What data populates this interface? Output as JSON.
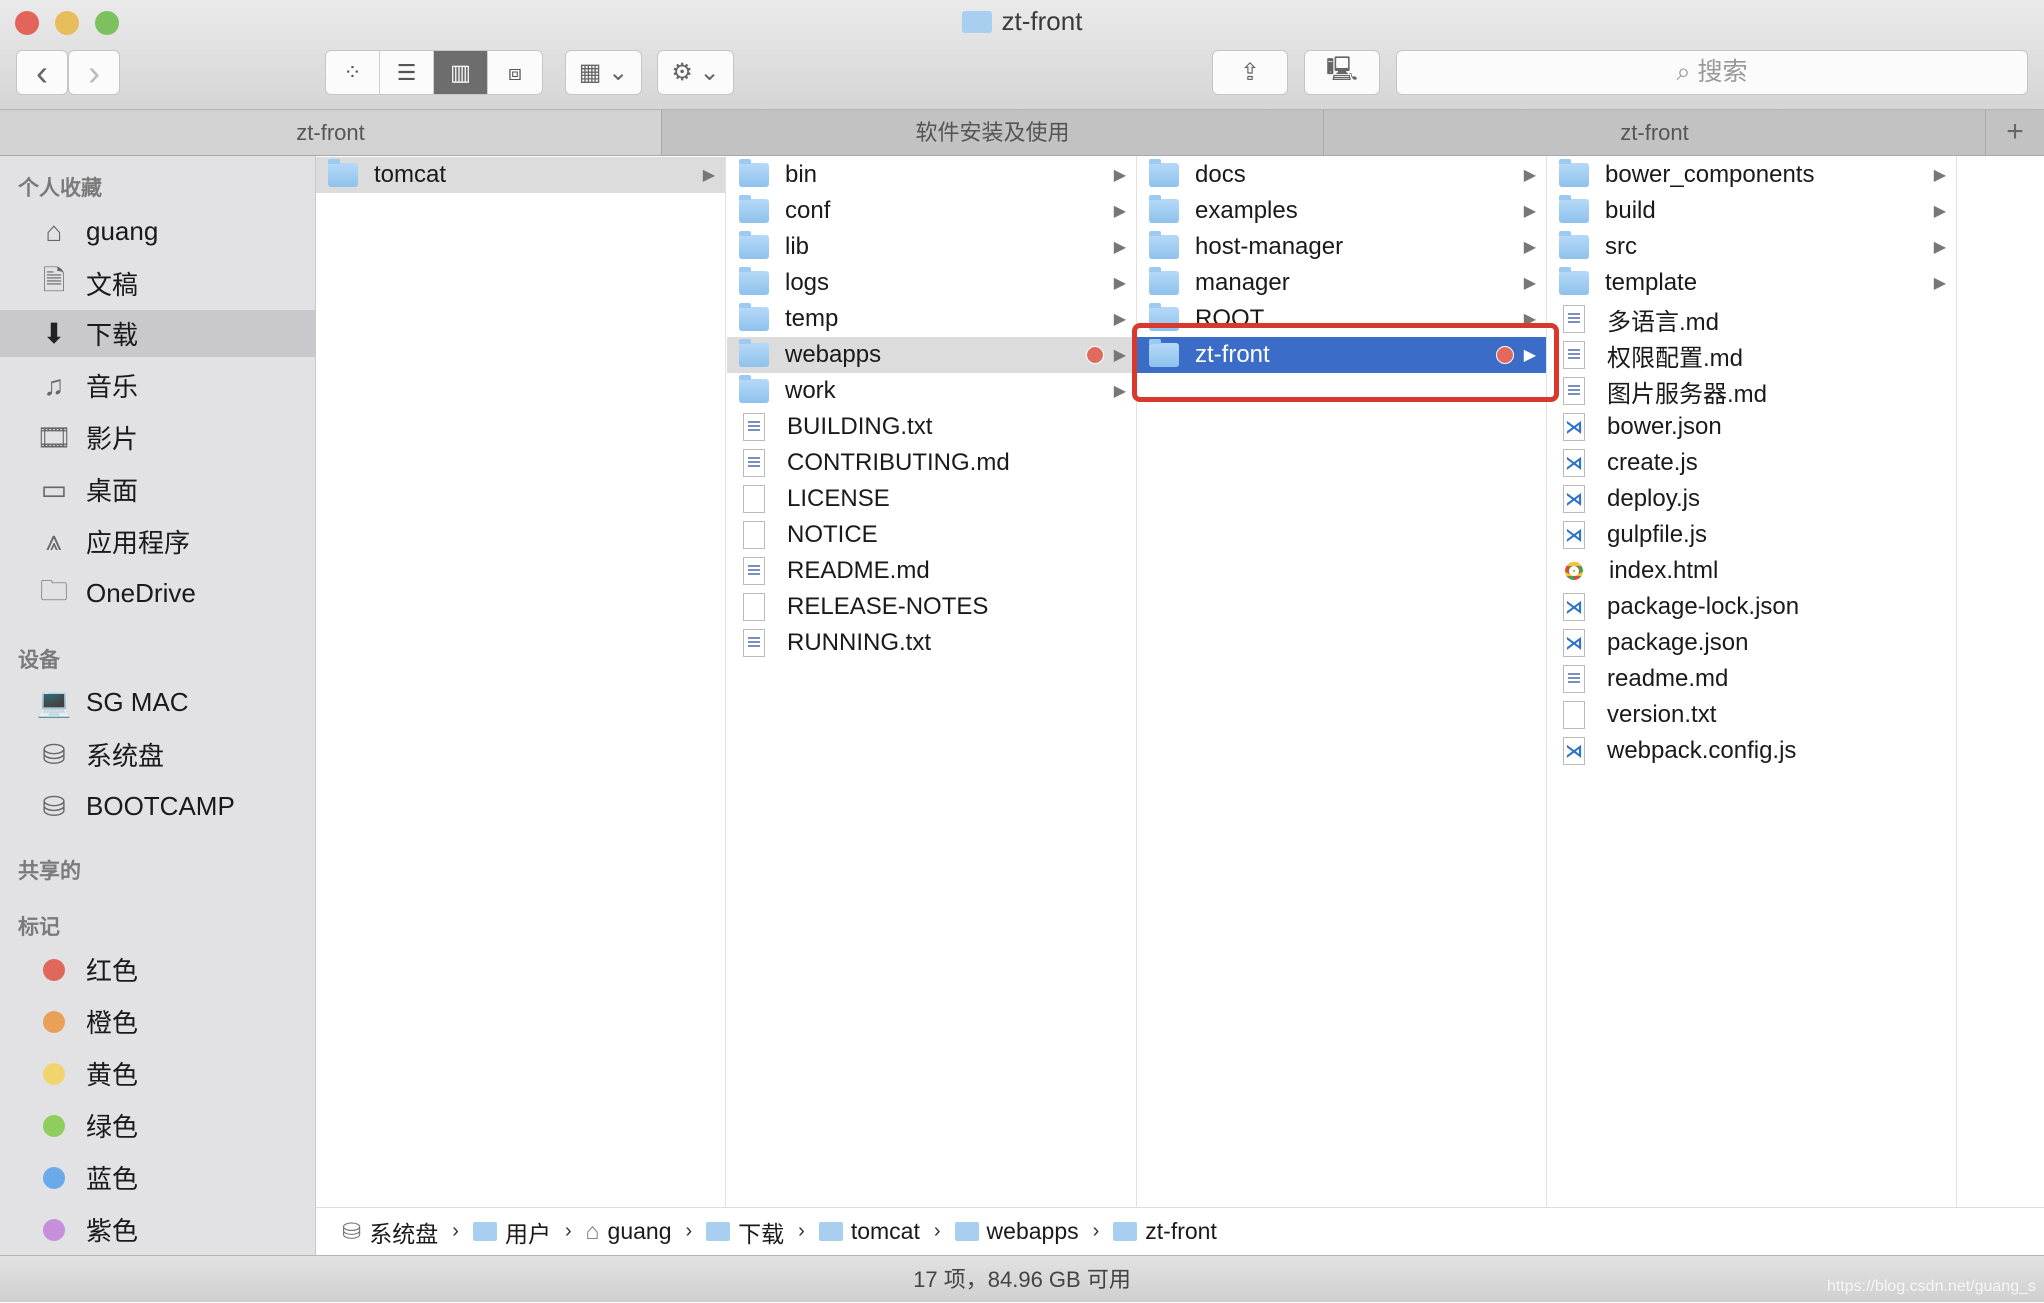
{
  "window": {
    "title": "zt-front"
  },
  "toolbar": {
    "back": "‹",
    "forward": "›",
    "search_placeholder": "搜索"
  },
  "tabs": [
    {
      "label": "zt-front",
      "active": true
    },
    {
      "label": "软件安装及使用",
      "active": false
    },
    {
      "label": "zt-front",
      "active": false
    }
  ],
  "sidebar": {
    "sections": [
      {
        "header": "个人收藏",
        "items": [
          {
            "label": "guang",
            "icon": "home-icon"
          },
          {
            "label": "文稿",
            "icon": "documents-icon"
          },
          {
            "label": "下载",
            "icon": "downloads-icon",
            "selected": true
          },
          {
            "label": "音乐",
            "icon": "music-icon"
          },
          {
            "label": "影片",
            "icon": "movies-icon"
          },
          {
            "label": "桌面",
            "icon": "desktop-icon"
          },
          {
            "label": "应用程序",
            "icon": "applications-icon"
          },
          {
            "label": "OneDrive",
            "icon": "folder-icon"
          }
        ]
      },
      {
        "header": "设备",
        "items": [
          {
            "label": "SG MAC",
            "icon": "laptop-icon"
          },
          {
            "label": "系统盘",
            "icon": "disk-icon"
          },
          {
            "label": "BOOTCAMP",
            "icon": "disk-icon"
          }
        ]
      },
      {
        "header": "共享的",
        "items": []
      },
      {
        "header": "标记",
        "items": [
          {
            "label": "红色",
            "color": "#e0675c"
          },
          {
            "label": "橙色",
            "color": "#e9a157"
          },
          {
            "label": "黄色",
            "color": "#f2d46e"
          },
          {
            "label": "绿色",
            "color": "#8fcd5f"
          },
          {
            "label": "蓝色",
            "color": "#6aa9ea"
          },
          {
            "label": "紫色",
            "color": "#c58fdc"
          }
        ]
      }
    ]
  },
  "columns": [
    [
      {
        "name": "tomcat",
        "type": "folder",
        "state": "gray"
      }
    ],
    [
      {
        "name": "bin",
        "type": "folder"
      },
      {
        "name": "conf",
        "type": "folder"
      },
      {
        "name": "lib",
        "type": "folder"
      },
      {
        "name": "logs",
        "type": "folder"
      },
      {
        "name": "temp",
        "type": "folder"
      },
      {
        "name": "webapps",
        "type": "folder",
        "state": "gray",
        "tag": true
      },
      {
        "name": "work",
        "type": "folder"
      },
      {
        "name": "BUILDING.txt",
        "type": "doc"
      },
      {
        "name": "CONTRIBUTING.md",
        "type": "doc"
      },
      {
        "name": "LICENSE",
        "type": "blank"
      },
      {
        "name": "NOTICE",
        "type": "blank"
      },
      {
        "name": "README.md",
        "type": "doc"
      },
      {
        "name": "RELEASE-NOTES",
        "type": "blank"
      },
      {
        "name": "RUNNING.txt",
        "type": "doc"
      }
    ],
    [
      {
        "name": "docs",
        "type": "folder"
      },
      {
        "name": "examples",
        "type": "folder"
      },
      {
        "name": "host-manager",
        "type": "folder"
      },
      {
        "name": "manager",
        "type": "folder"
      },
      {
        "name": "ROOT",
        "type": "folder"
      },
      {
        "name": "zt-front",
        "type": "folder",
        "state": "blue",
        "tag": true
      }
    ],
    [
      {
        "name": "bower_components",
        "type": "folder"
      },
      {
        "name": "build",
        "type": "folder"
      },
      {
        "name": "src",
        "type": "folder"
      },
      {
        "name": "template",
        "type": "folder"
      },
      {
        "name": "多语言.md",
        "type": "doc"
      },
      {
        "name": "权限配置.md",
        "type": "doc"
      },
      {
        "name": "图片服务器.md",
        "type": "doc"
      },
      {
        "name": "bower.json",
        "type": "code"
      },
      {
        "name": "create.js",
        "type": "code"
      },
      {
        "name": "deploy.js",
        "type": "code"
      },
      {
        "name": "gulpfile.js",
        "type": "code"
      },
      {
        "name": "index.html",
        "type": "chrome"
      },
      {
        "name": "package-lock.json",
        "type": "code"
      },
      {
        "name": "package.json",
        "type": "code"
      },
      {
        "name": "readme.md",
        "type": "doc"
      },
      {
        "name": "version.txt",
        "type": "blank"
      },
      {
        "name": "webpack.config.js",
        "type": "code"
      }
    ]
  ],
  "pathbar": [
    {
      "label": "系统盘",
      "icon": "disk-icon"
    },
    {
      "label": "用户",
      "icon": "folder-icon"
    },
    {
      "label": "guang",
      "icon": "home-icon"
    },
    {
      "label": "下载",
      "icon": "folder-icon"
    },
    {
      "label": "tomcat",
      "icon": "folder-icon"
    },
    {
      "label": "webapps",
      "icon": "folder-icon"
    },
    {
      "label": "zt-front",
      "icon": "folder-icon"
    }
  ],
  "status": "17 项，84.96 GB 可用",
  "watermark": "https://blog.csdn.net/guang_s",
  "colors": {
    "selection": "#3b6dc8",
    "highlight_box": "#d9392c",
    "tag_red": "#e06a5e"
  }
}
